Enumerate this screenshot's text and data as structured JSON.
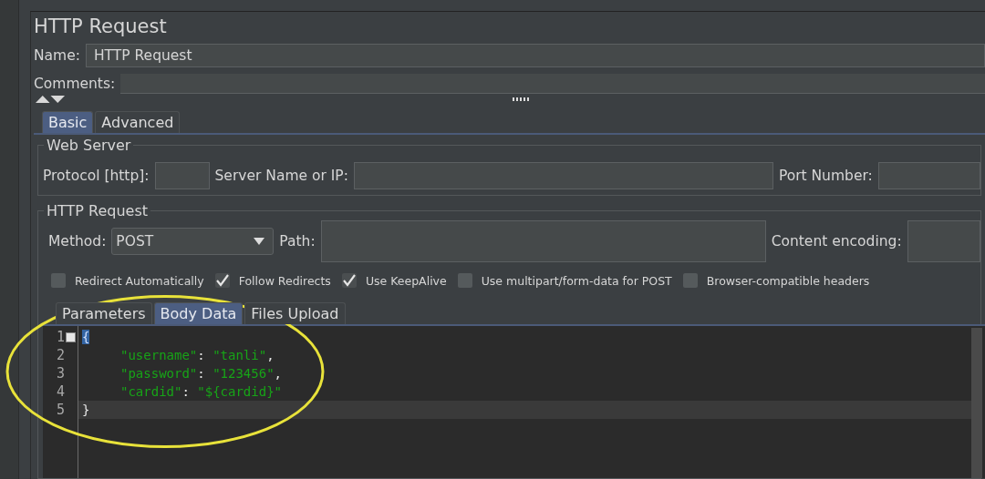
{
  "panel": {
    "title": "HTTP Request",
    "name_label": "Name:",
    "name_value": "HTTP Request",
    "comments_label": "Comments:"
  },
  "tabs": [
    {
      "label": "Basic",
      "selected": true
    },
    {
      "label": "Advanced",
      "selected": false
    }
  ],
  "web_server": {
    "legend": "Web Server",
    "protocol_label": "Protocol [http]:",
    "server_label": "Server Name or IP:",
    "port_label": "Port Number:"
  },
  "http_request": {
    "legend": "HTTP Request",
    "method_label": "Method:",
    "method_value": "POST",
    "path_label": "Path:",
    "encoding_label": "Content encoding:",
    "options": [
      {
        "label": "Redirect Automatically",
        "checked": false
      },
      {
        "label": "Follow Redirects",
        "checked": true
      },
      {
        "label": "Use KeepAlive",
        "checked": true
      },
      {
        "label": "Use multipart/form-data for POST",
        "checked": false
      },
      {
        "label": "Browser-compatible headers",
        "checked": false
      }
    ]
  },
  "body_tabs": [
    {
      "label": "Parameters",
      "selected": false
    },
    {
      "label": "Body Data",
      "selected": true
    },
    {
      "label": "Files Upload",
      "selected": false
    }
  ],
  "editor": {
    "lines": [
      {
        "number": "1",
        "kind": "brace",
        "current": false,
        "tokens": [
          {
            "text": "{",
            "kind": "matched"
          }
        ]
      },
      {
        "number": "2",
        "kind": "member",
        "current": false,
        "tokens": [
          {
            "text": "\"username\"",
            "kind": "string"
          },
          {
            "text": ": ",
            "kind": "plain"
          },
          {
            "text": "\"tanli\"",
            "kind": "string"
          },
          {
            "text": ",",
            "kind": "plain"
          }
        ]
      },
      {
        "number": "3",
        "kind": "member",
        "current": false,
        "tokens": [
          {
            "text": "\"password\"",
            "kind": "string"
          },
          {
            "text": ": ",
            "kind": "plain"
          },
          {
            "text": "\"123456\"",
            "kind": "string"
          },
          {
            "text": ",",
            "kind": "plain"
          }
        ]
      },
      {
        "number": "4",
        "kind": "member",
        "current": false,
        "tokens": [
          {
            "text": "\"cardid\"",
            "kind": "string"
          },
          {
            "text": ": ",
            "kind": "plain"
          },
          {
            "text": "\"${cardid}\"",
            "kind": "string"
          }
        ]
      },
      {
        "number": "5",
        "kind": "brace",
        "current": true,
        "tokens": [
          {
            "text": "}",
            "kind": "plain"
          }
        ]
      }
    ]
  }
}
